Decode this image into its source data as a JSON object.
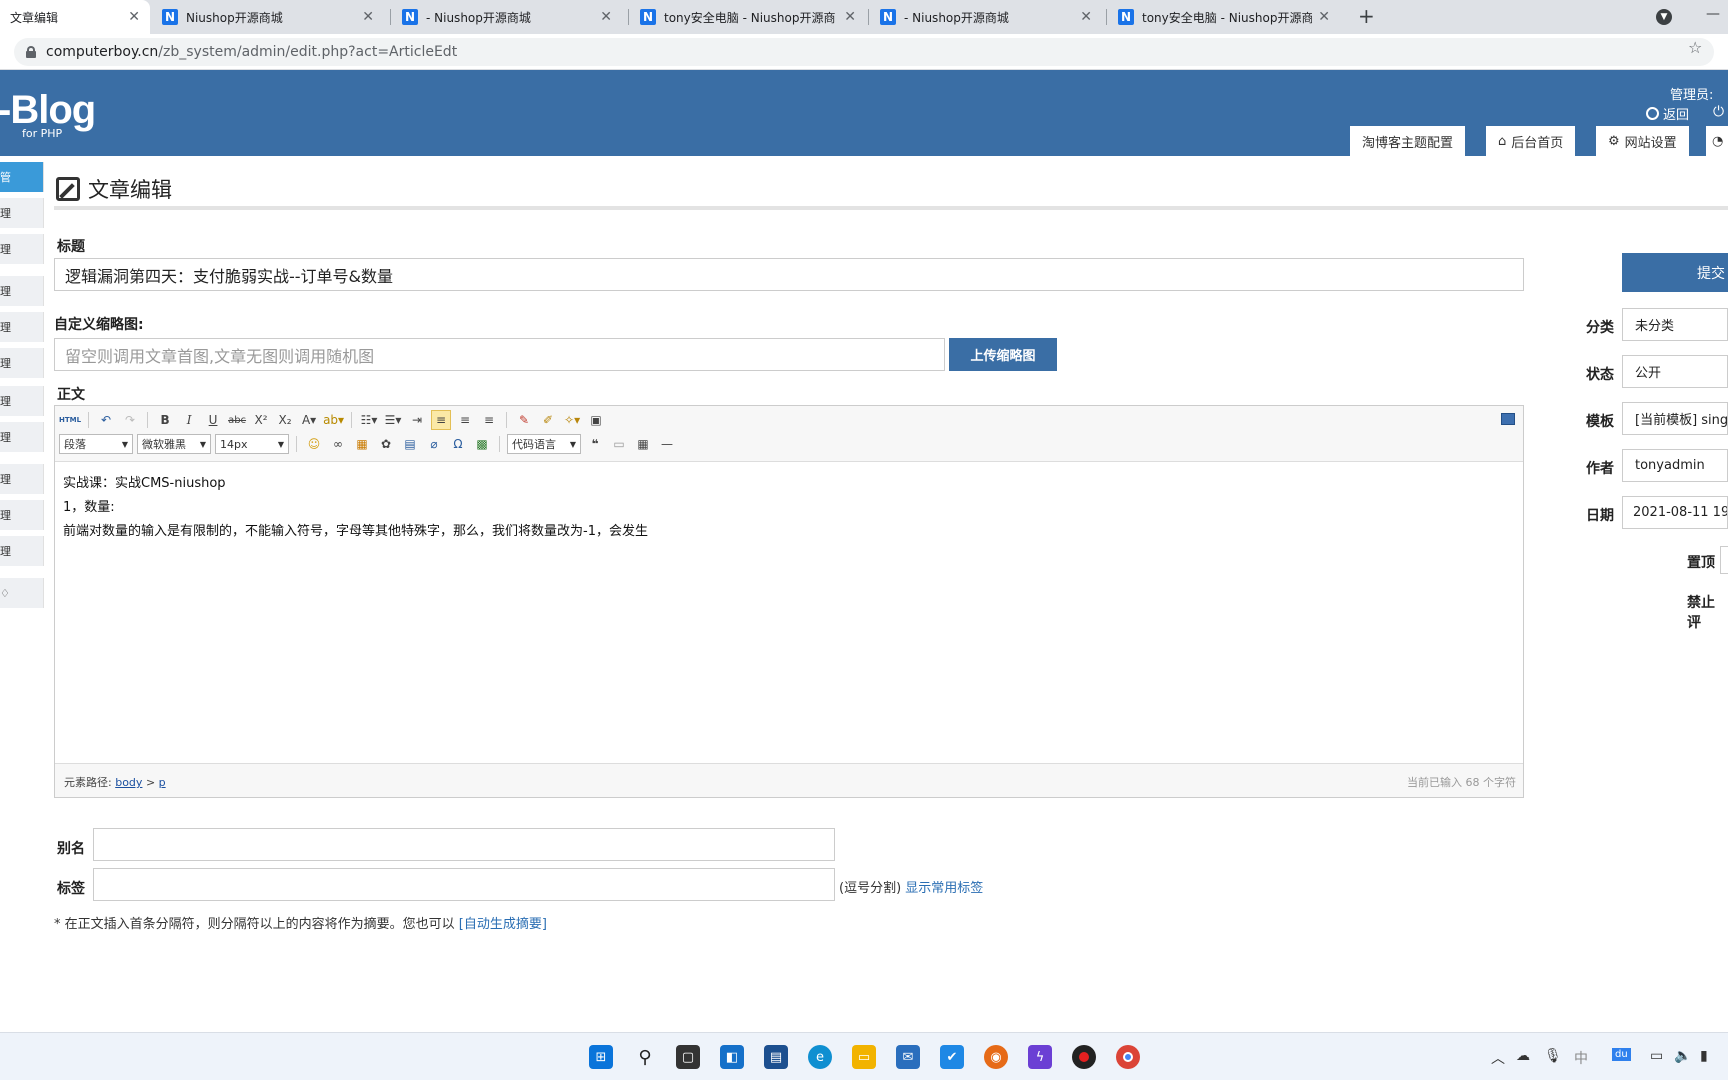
{
  "browser": {
    "tabs": [
      {
        "title": "文章编辑",
        "icon": ""
      },
      {
        "title": "Niushop开源商城",
        "icon": "N"
      },
      {
        "title": "- Niushop开源商城",
        "icon": "N"
      },
      {
        "title": "tony安全电脑 - Niushop开源商",
        "icon": "N"
      },
      {
        "title": "- Niushop开源商城",
        "icon": "N"
      },
      {
        "title": "tony安全电脑 - Niushop开源商",
        "icon": "N"
      }
    ],
    "url_host": "computerboy.cn",
    "url_path": "/zb_system/admin/edit.php?act=ArticleEdt"
  },
  "header": {
    "logo": "-Blog",
    "logo_sub": "for PHP",
    "admin_label": "管理员:",
    "return_label": "返回",
    "nav_tabs": [
      {
        "label": "淘博客主题配置",
        "icon": ""
      },
      {
        "label": "后台首页",
        "icon": "⌂"
      },
      {
        "label": "网站设置",
        "icon": "⚙"
      }
    ]
  },
  "sidebar": {
    "items": [
      "管",
      "理",
      "理",
      "理",
      "理",
      "理",
      "理",
      "理",
      "理",
      "理",
      "理",
      "♢"
    ]
  },
  "page": {
    "title": "文章编辑",
    "title_label": "标题",
    "title_value": "逻辑漏洞第四天：支付脆弱实战--订单号&数量",
    "thumb_label": "自定义缩略图:",
    "thumb_placeholder": "留空则调用文章首图,文章无图则调用随机图",
    "upload_button": "上传缩略图",
    "content_label": "正文",
    "alias_label": "别名",
    "alias_value": "",
    "tags_label": "标签",
    "tags_value": "",
    "tags_hint": "(逗号分割)",
    "tags_link": "显示常用标签",
    "summary_note": "* 在正文插入首条分隔符，则分隔符以上的内容将作为摘要。您也可以",
    "summary_link": "[自动生成摘要]"
  },
  "editor": {
    "paragraph_select": "段落",
    "font_select": "微软雅黑",
    "size_select": "14px",
    "code_select": "代码语言",
    "lines": [
      "实战课：实战CMS-niushop",
      "1，数量:",
      "前端对数量的输入是有限制的，不能输入符号，字母等其他特殊字，那么，我们将数量改为-1，会发生"
    ],
    "status_path_label": "元素路径:",
    "status_path_body": "body",
    "status_path_sep": ">",
    "status_path_p": "p",
    "status_count": "当前已输入 68 个字符"
  },
  "right_panel": {
    "submit_label": "提交",
    "category_label": "分类",
    "category_value": "未分类",
    "status_label": "状态",
    "status_value": "公开",
    "template_label": "模板",
    "template_value": "[当前模板] sing",
    "author_label": "作者",
    "author_value": "tonyadmin",
    "date_label": "日期",
    "date_value": "2021-08-11 19:",
    "pin_label": "置顶",
    "disable_comment_label": "禁止评"
  },
  "colors": {
    "header_blue": "#3a6ea5",
    "sidebar_active": "#3a9ad9"
  }
}
